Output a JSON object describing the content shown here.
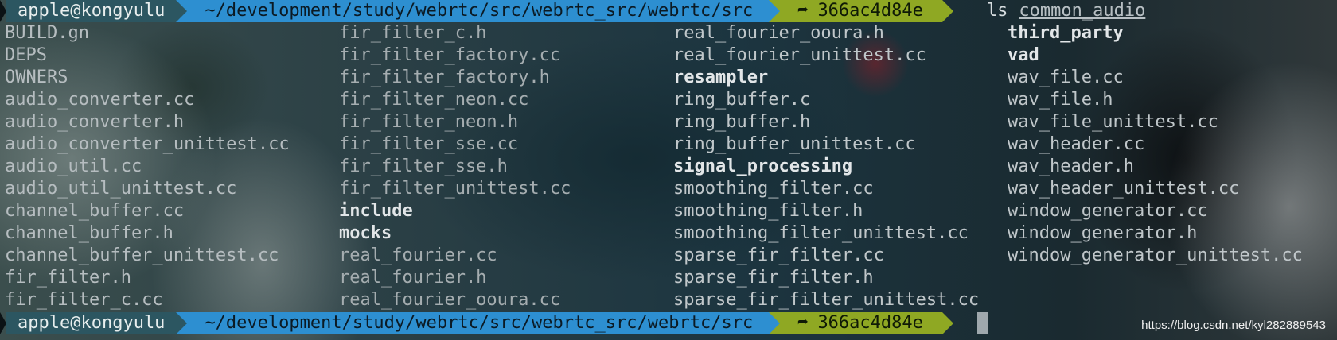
{
  "prompt": {
    "user_host": "apple@kongyulu",
    "path": "~/development/study/webrtc/src/webrtc_src/webrtc/src",
    "git_symbol": "➦",
    "git_hash": "366ac4d84e"
  },
  "command": {
    "name": "ls",
    "arg": "common_audio"
  },
  "listing": [
    {
      "name": "BUILD.gn",
      "dir": false
    },
    {
      "name": "DEPS",
      "dir": false
    },
    {
      "name": "OWNERS",
      "dir": false
    },
    {
      "name": "audio_converter.cc",
      "dir": false
    },
    {
      "name": "audio_converter.h",
      "dir": false
    },
    {
      "name": "audio_converter_unittest.cc",
      "dir": false
    },
    {
      "name": "audio_util.cc",
      "dir": false
    },
    {
      "name": "audio_util_unittest.cc",
      "dir": false
    },
    {
      "name": "channel_buffer.cc",
      "dir": false
    },
    {
      "name": "channel_buffer.h",
      "dir": false
    },
    {
      "name": "channel_buffer_unittest.cc",
      "dir": false
    },
    {
      "name": "fir_filter.h",
      "dir": false
    },
    {
      "name": "fir_filter_c.cc",
      "dir": false
    },
    {
      "name": "fir_filter_c.h",
      "dir": false
    },
    {
      "name": "fir_filter_factory.cc",
      "dir": false
    },
    {
      "name": "fir_filter_factory.h",
      "dir": false
    },
    {
      "name": "fir_filter_neon.cc",
      "dir": false
    },
    {
      "name": "fir_filter_neon.h",
      "dir": false
    },
    {
      "name": "fir_filter_sse.cc",
      "dir": false
    },
    {
      "name": "fir_filter_sse.h",
      "dir": false
    },
    {
      "name": "fir_filter_unittest.cc",
      "dir": false
    },
    {
      "name": "include",
      "dir": true
    },
    {
      "name": "mocks",
      "dir": true
    },
    {
      "name": "real_fourier.cc",
      "dir": false
    },
    {
      "name": "real_fourier.h",
      "dir": false
    },
    {
      "name": "real_fourier_ooura.cc",
      "dir": false
    },
    {
      "name": "real_fourier_ooura.h",
      "dir": false
    },
    {
      "name": "real_fourier_unittest.cc",
      "dir": false
    },
    {
      "name": "resampler",
      "dir": true
    },
    {
      "name": "ring_buffer.c",
      "dir": false
    },
    {
      "name": "ring_buffer.h",
      "dir": false
    },
    {
      "name": "ring_buffer_unittest.cc",
      "dir": false
    },
    {
      "name": "signal_processing",
      "dir": true
    },
    {
      "name": "smoothing_filter.cc",
      "dir": false
    },
    {
      "name": "smoothing_filter.h",
      "dir": false
    },
    {
      "name": "smoothing_filter_unittest.cc",
      "dir": false
    },
    {
      "name": "sparse_fir_filter.cc",
      "dir": false
    },
    {
      "name": "sparse_fir_filter.h",
      "dir": false
    },
    {
      "name": "sparse_fir_filter_unittest.cc",
      "dir": false
    },
    {
      "name": "third_party",
      "dir": true
    },
    {
      "name": "vad",
      "dir": true
    },
    {
      "name": "wav_file.cc",
      "dir": false
    },
    {
      "name": "wav_file.h",
      "dir": false
    },
    {
      "name": "wav_file_unittest.cc",
      "dir": false
    },
    {
      "name": "wav_header.cc",
      "dir": false
    },
    {
      "name": "wav_header.h",
      "dir": false
    },
    {
      "name": "wav_header_unittest.cc",
      "dir": false
    },
    {
      "name": "window_generator.cc",
      "dir": false
    },
    {
      "name": "window_generator.h",
      "dir": false
    },
    {
      "name": "window_generator_unittest.cc",
      "dir": false
    }
  ],
  "watermark": "https://blog.csdn.net/kyl282889543",
  "colors": {
    "user_segment": "#2c5661",
    "path_segment": "#2d8fd1",
    "git_segment": "#8fa823"
  }
}
